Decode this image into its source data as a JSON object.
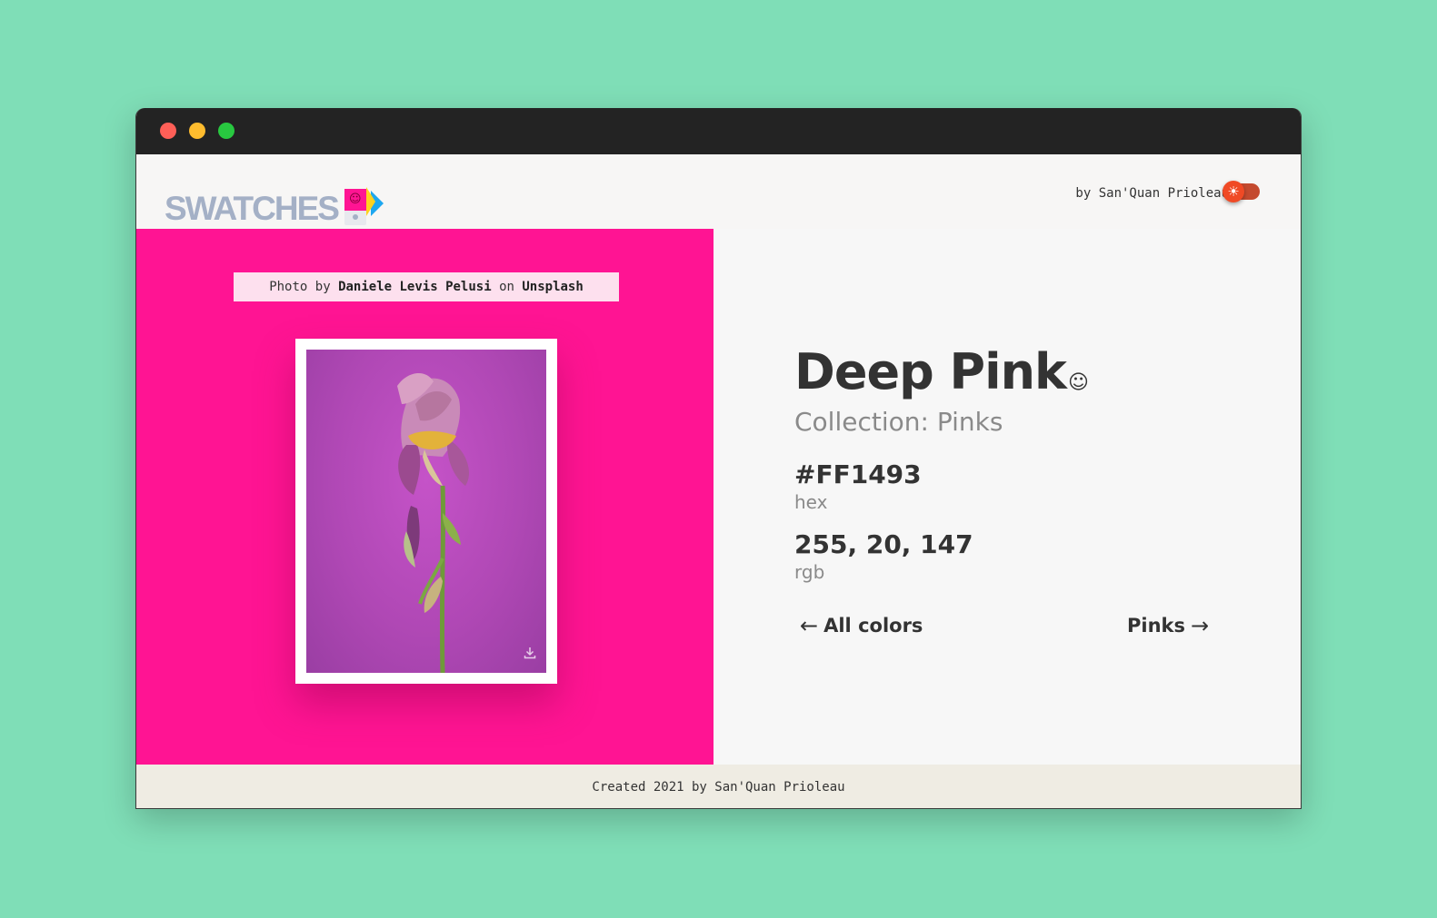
{
  "window": {
    "controls": [
      "close",
      "minimize",
      "maximize"
    ]
  },
  "header": {
    "logo_text": "SWATCHES",
    "byline": "by San'Quan Prioleau",
    "theme_toggle_icon": "sun-icon"
  },
  "photo": {
    "credit_prefix": "Photo by ",
    "credit_author": "Daniele Levis Pelusi",
    "credit_middle": " on ",
    "credit_source": "Unsplash",
    "download_icon": "download-icon"
  },
  "detail": {
    "name": "Deep Pink",
    "name_icon": "☺",
    "collection": "Collection: Pinks",
    "hex_value": "#FF1493",
    "hex_label": "hex",
    "rgb_value": "255, 20, 147",
    "rgb_label": "rgb",
    "back_link": "All colors",
    "back_arrow": "←",
    "next_link": "Pinks",
    "next_arrow": "→"
  },
  "footer": {
    "text": "Created 2021 by San'Quan Prioleau"
  },
  "colors": {
    "swatch": "#FF1493",
    "background": "#7FDEB7",
    "toggle": "#F04A25"
  }
}
